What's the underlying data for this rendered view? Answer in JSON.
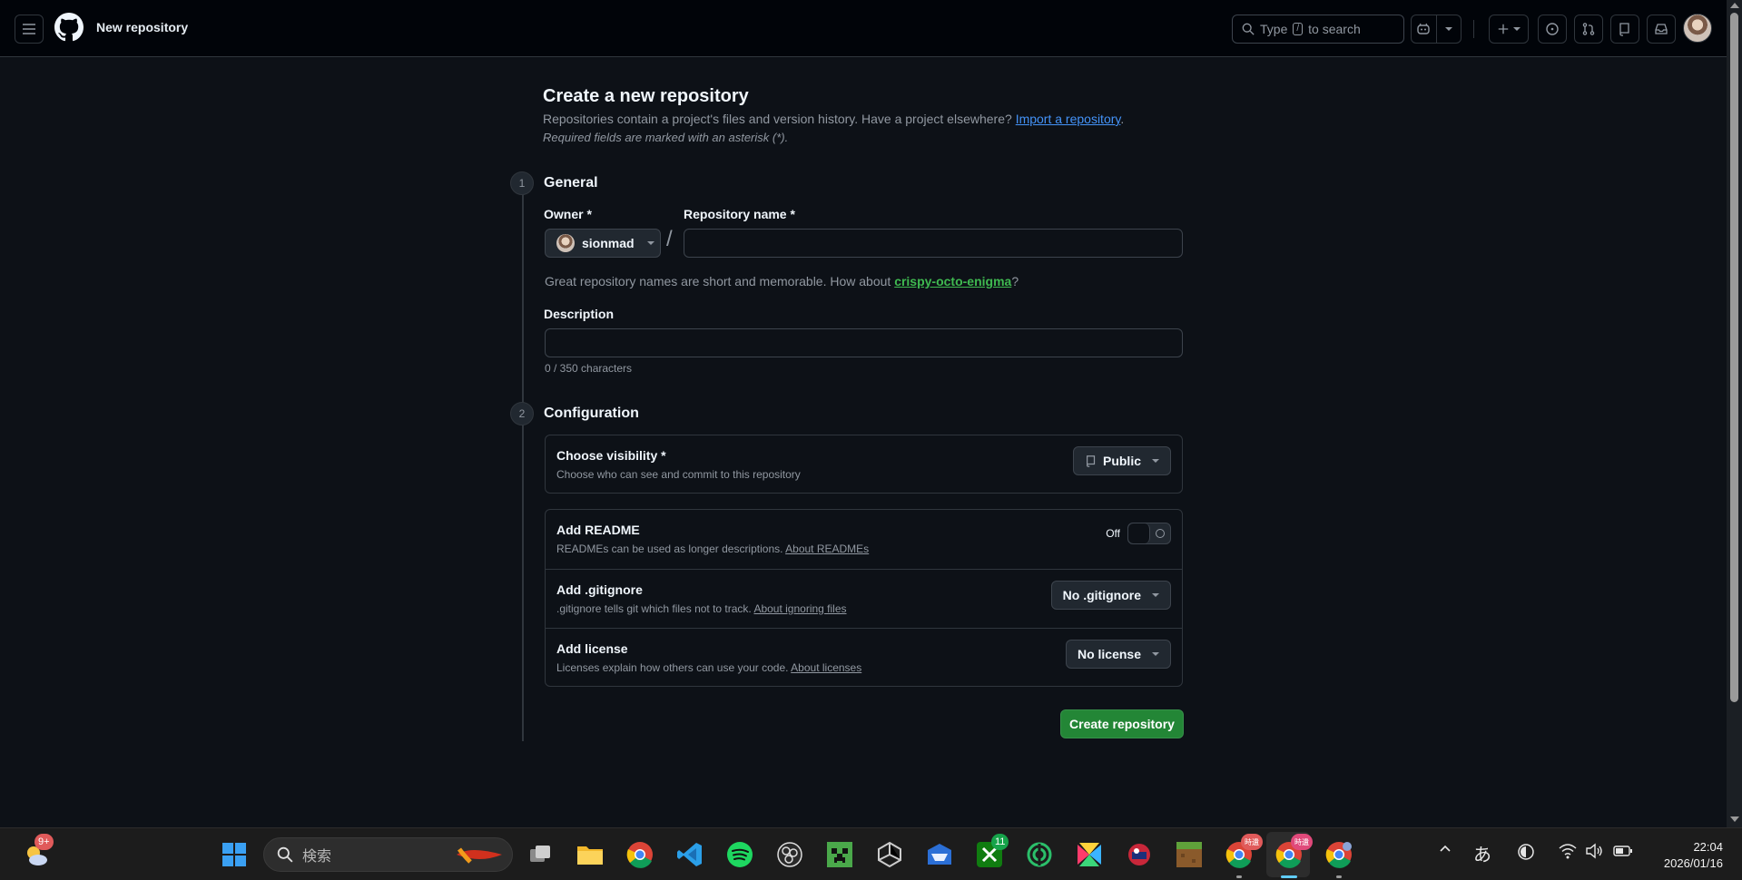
{
  "header": {
    "page_context": "New repository",
    "search_placeholder_pre": "Type",
    "search_key": "/",
    "search_placeholder_post": "to search"
  },
  "form": {
    "title": "Create a new repository",
    "lead_text": "Repositories contain a project's files and version history. Have a project elsewhere?",
    "import_link": "Import a repository",
    "lead_end": ".",
    "required_note": "Required fields are marked with an asterisk (*).",
    "step1": {
      "number": "1",
      "title": "General"
    },
    "owner_label": "Owner *",
    "owner_value": "sionmad",
    "repo_name_label": "Repository name *",
    "repo_name_value": "",
    "hint_pre": "Great repository names are short and memorable. How about",
    "hint_suggestion": "crispy-octo-enigma",
    "hint_post": "?",
    "description_label": "Description",
    "description_value": "",
    "char_count": "0 / 350 characters",
    "step2": {
      "number": "2",
      "title": "Configuration"
    },
    "visibility": {
      "title": "Choose visibility *",
      "desc": "Choose who can see and commit to this repository",
      "value": "Public"
    },
    "readme": {
      "title": "Add README",
      "desc": "READMEs can be used as longer descriptions.",
      "link": "About READMEs",
      "toggle_label": "Off"
    },
    "gitignore": {
      "title": "Add .gitignore",
      "desc": ".gitignore tells git which files not to track.",
      "link": "About ignoring files",
      "value": "No .gitignore"
    },
    "license": {
      "title": "Add license",
      "desc": "Licenses explain how others can use your code.",
      "link": "About licenses",
      "value": "No license"
    },
    "create_button": "Create repository"
  },
  "taskbar": {
    "search_placeholder": "検索",
    "weather_badge": "9+",
    "xbox_badge": "11",
    "chrome_badge_1": "時遺",
    "chrome_badge_2": "時遺",
    "ime": "あ",
    "time": "22:04",
    "date": "2026/01/16",
    "icons": [
      "weather-icon",
      "windows-start-icon",
      "search-icon",
      "task-view-icon",
      "file-explorer-icon",
      "chrome-icon",
      "vscode-icon",
      "spotify-icon",
      "obs-icon",
      "minecraft-icon",
      "unity-icon",
      "email-icon",
      "xbox-icon",
      "network-app-icon",
      "figma-icon",
      "game-icon",
      "minecraft-block-icon",
      "chrome-profile-icon"
    ]
  },
  "colors": {
    "bg": "#0d1117",
    "header_bg": "#010409",
    "accent_link": "#4493f8",
    "success": "#238636",
    "suggestion": "#3fb950"
  }
}
